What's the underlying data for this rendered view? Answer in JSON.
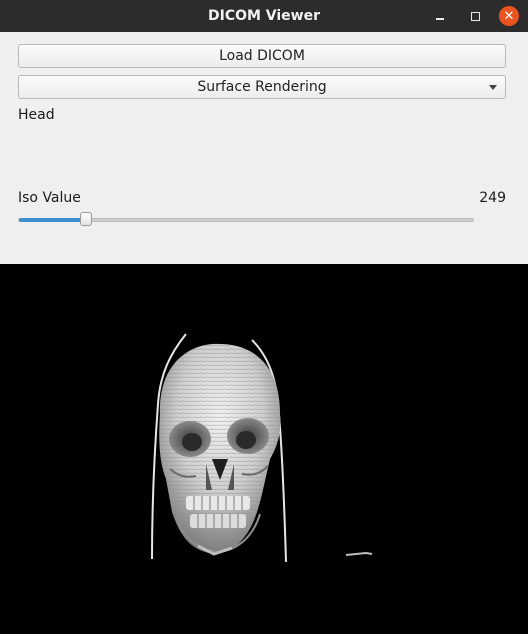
{
  "window": {
    "title": "DICOM Viewer"
  },
  "controls": {
    "load_button": "Load DICOM",
    "render_mode": {
      "selected": "Surface Rendering"
    },
    "dataset_label": "Head",
    "iso": {
      "label": "Iso Value",
      "value": "249",
      "slider_fraction": 0.14
    }
  },
  "viewport": {
    "background": "#000000",
    "content": "skull-surface-render"
  },
  "colors": {
    "accent": "#3d8fd1",
    "close": "#e95420"
  }
}
